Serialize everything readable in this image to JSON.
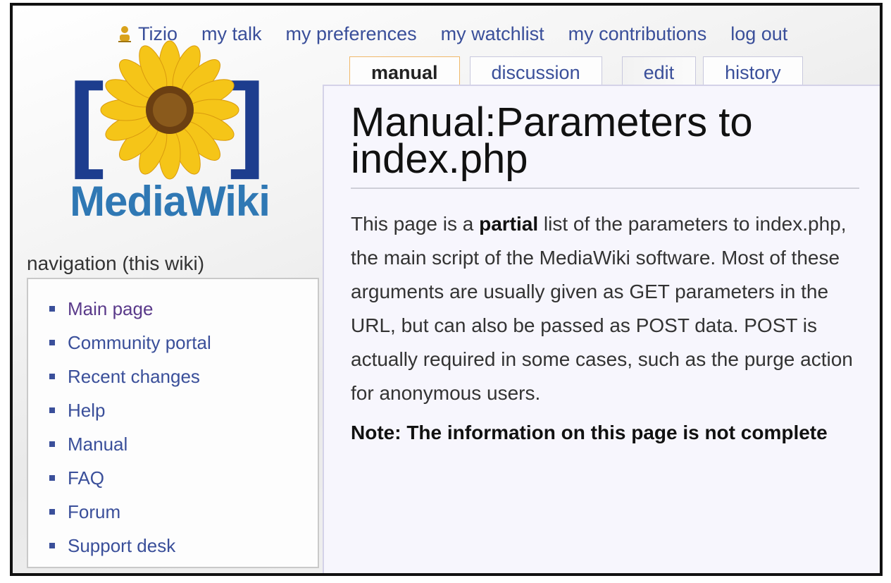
{
  "personal_tools": {
    "username": "Tizio",
    "links": [
      "my talk",
      "my preferences",
      "my watchlist",
      "my contributions",
      "log out"
    ]
  },
  "logo": {
    "text": "MediaWiki",
    "icon": "sunflower-logo"
  },
  "tabs": [
    {
      "label": "manual",
      "selected": true
    },
    {
      "label": "discussion",
      "selected": false
    },
    {
      "label": "edit",
      "selected": false
    },
    {
      "label": "history",
      "selected": false
    }
  ],
  "page": {
    "title": "Manual:Parameters to index.php",
    "intro_before_bold": "This page is a ",
    "intro_bold": "partial",
    "intro_after_bold": " list of the parameters to index.php, the main script of the MediaWiki software. Most of these arguments are usually given as GET parameters in the URL, but can also be passed as POST data. POST is actually required in some cases, such as the purge action for anonymous users.",
    "note": "Note: The information on this page is not complete"
  },
  "sidebar": {
    "heading": "navigation (this wiki)",
    "items": [
      {
        "label": "Main page"
      },
      {
        "label": "Community portal"
      },
      {
        "label": "Recent changes"
      },
      {
        "label": "Help"
      },
      {
        "label": "Manual"
      },
      {
        "label": "FAQ"
      },
      {
        "label": "Forum"
      },
      {
        "label": "Support desk"
      }
    ]
  },
  "colors": {
    "link": "#3a4f9a",
    "content_bg": "#f7f6fd",
    "selected_tab_border": "#f0b86a",
    "logo_text": "#2f78b4"
  }
}
